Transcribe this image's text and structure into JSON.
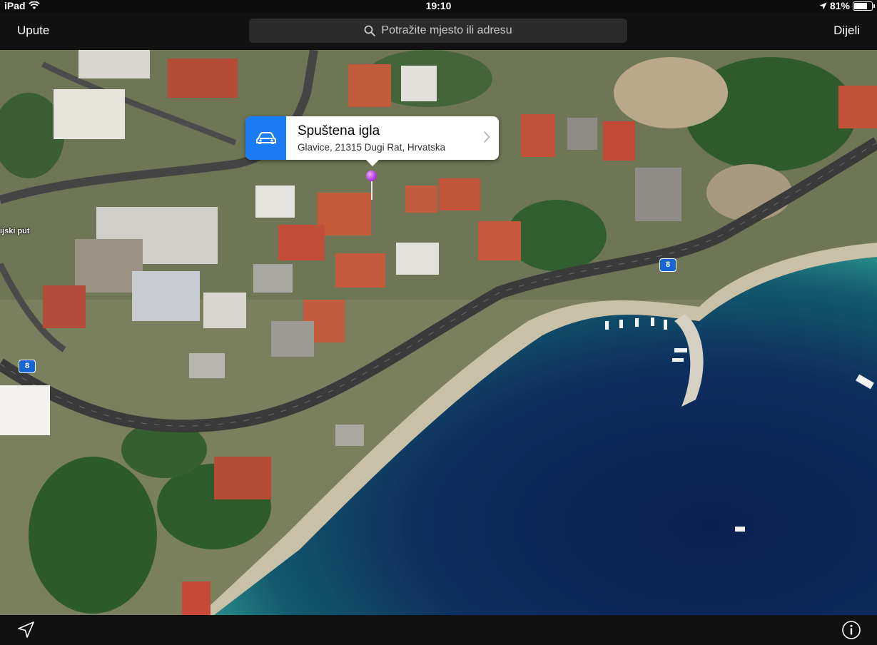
{
  "status_bar": {
    "device": "iPad",
    "time": "19:10",
    "battery": "81%",
    "battery_level": 0.81,
    "icons": [
      "wifi-icon",
      "location-arrow-icon",
      "battery-icon"
    ]
  },
  "nav": {
    "left_label": "Upute",
    "right_label": "Dijeli",
    "search_placeholder": "Potražite mjesto ili adresu",
    "search_icon": "search-icon"
  },
  "callout": {
    "title": "Spuštena igla",
    "subtitle": "Glavice, 21315 Dugi Rat, Hrvatska",
    "icon": "car-icon",
    "accent": "#1a7bf2"
  },
  "map": {
    "road_label": "ijski put",
    "route_shields": [
      "8",
      "8"
    ],
    "pin_color": "#c04ae0",
    "view": "satellite"
  },
  "bottom_bar": {
    "left_icon": "location-arrow-icon",
    "right_icon": "info-icon"
  }
}
